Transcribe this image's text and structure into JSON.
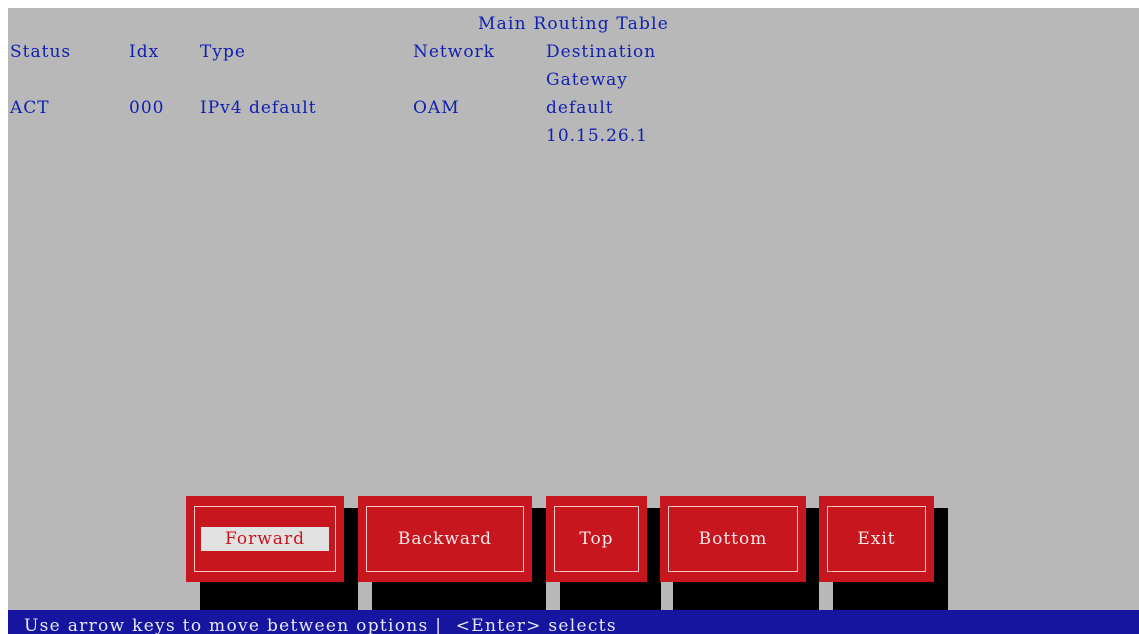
{
  "title": "Main Routing Table",
  "columns": {
    "status": "Status",
    "idx": "Idx",
    "type": "Type",
    "network": "Network",
    "destination": "Destination",
    "gateway": "Gateway"
  },
  "rows": [
    {
      "status": "ACT",
      "idx": "000",
      "type": "IPv4 default",
      "network": "OAM",
      "destination": "default",
      "gateway": "10.15.26.1"
    }
  ],
  "buttons": [
    {
      "label": "Forward",
      "selected": true
    },
    {
      "label": "Backward",
      "selected": false
    },
    {
      "label": "Top",
      "selected": false
    },
    {
      "label": "Bottom",
      "selected": false
    },
    {
      "label": "Exit",
      "selected": false
    }
  ],
  "status_bar": {
    "message": "Use arrow keys to move between options |  <Enter> selects"
  },
  "colors": {
    "background": "#b8b8b8",
    "text": "#1020b0",
    "button": "#c8161e",
    "status_bar": "#1515a0"
  }
}
